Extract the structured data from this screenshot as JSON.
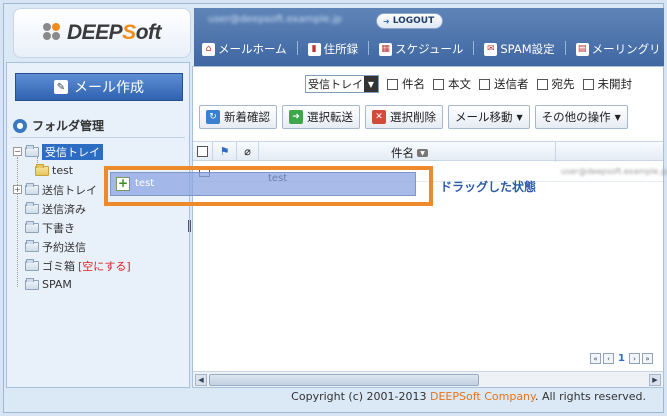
{
  "logo": {
    "prefix": "DEEP",
    "s": "S",
    "suffix": "oft"
  },
  "header": {
    "user": "user@deepsoft.example.jp",
    "logout": "LOGOUT",
    "tabs": [
      {
        "label": "メールホーム",
        "icon": "home-icon",
        "glyph": "⌂"
      },
      {
        "label": "住所録",
        "icon": "address-book-icon",
        "glyph": "▮"
      },
      {
        "label": "スケジュール",
        "icon": "calendar-icon",
        "glyph": "▦"
      },
      {
        "label": "SPAM設定",
        "icon": "spam-icon",
        "glyph": "✉"
      },
      {
        "label": "メーリングリ",
        "icon": "mailing-list-icon",
        "glyph": "▤"
      }
    ]
  },
  "sidebar": {
    "compose": "メール作成",
    "folder_heading": "フォルダ管理",
    "folders": {
      "inbox": "受信トレイ",
      "test": "test",
      "sent": "送信トレイ",
      "sent_done": "送信済み",
      "drafts": "下書き",
      "scheduled": "予約送信",
      "trash": "ゴミ箱",
      "empty_trash": "[空にする]",
      "spam": "SPAM"
    }
  },
  "filter": {
    "selected_folder": "受信トレイ",
    "options": [
      "件名",
      "本文",
      "送信者",
      "宛先",
      "未開封"
    ]
  },
  "toolbar": {
    "check_new": "新着確認",
    "forward": "選択転送",
    "delete": "選択削除",
    "move": "メール移動",
    "other": "その他の操作"
  },
  "list": {
    "subject_header": "件名",
    "row_subject": "test",
    "row_sender": "user@deepsoft.example.jp",
    "page": "1"
  },
  "drag": {
    "ghost_label": "test",
    "annotation": "ドラッグした状態"
  },
  "footer": {
    "copyright": "Copyright (c) 2001-2013 ",
    "company": "DEEPSoft Company",
    "rights": ". All rights reserved."
  },
  "colors": {
    "accent": "#2c6cc3",
    "header": "#4a72ad",
    "highlight": "#ef8a2a",
    "annotation": "#2d5aa8"
  }
}
